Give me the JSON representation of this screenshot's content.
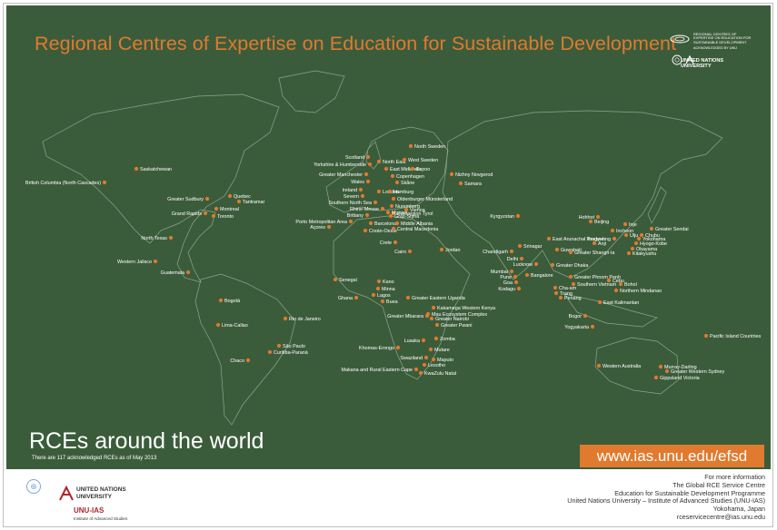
{
  "title": "Regional Centres of Expertise on Education for Sustainable Development",
  "logos_top": {
    "rce_logo_text": "REGIONAL CENTRES OF EXPERTISE ON EDUCATION FOR SUSTAINABLE DEVELOPMENT",
    "acknowledged_text": "ACKNOWLEDGED BY UNU",
    "unu_text": "UNITED NATIONS UNIVERSITY"
  },
  "bottom_left": {
    "heading": "RCEs around the world",
    "subheading": "There are 117 acknowledged RCEs as of May 2013"
  },
  "url": "www.ias.unu.edu/efsd",
  "footer": {
    "unu_name": "UNITED NATIONS UNIVERSITY",
    "unu_ias": "UNU-IAS",
    "unu_ias_sub": "Institute of Advanced Studies",
    "info_lines": [
      "For more information",
      "The Global RCE Service Centre",
      "Education for Sustainable Development Programme",
      "United Nations University – Institute of Advanced Studies (UNU-IAS)",
      "Yokohama, Japan",
      "rceservicecentre@ias.unu.edu"
    ]
  },
  "colors": {
    "background": "#3b5c3b",
    "accent": "#e07a2e",
    "text": "#ffffff"
  },
  "map_labels": [
    "British Columbia (North Cascades)",
    "Saskatchewan",
    "Greater Sudbury",
    "Quebec",
    "Tantramar",
    "Grand Rapids",
    "Montreal",
    "Toronto",
    "North Texas",
    "Western Jalisco",
    "Guatemala",
    "Bogotá",
    "Lima-Callao",
    "Rio de Janeiro",
    "São Paulo",
    "Curitiba-Paraná",
    "Chaco",
    "Scotland",
    "Yorkshire & Humberside",
    "North East",
    "East Midlands",
    "Greater Manchester",
    "Wales",
    "Ireland",
    "Severn",
    "London",
    "Southern North Sea",
    "Rhine-Meuse",
    "Euroregion Tyrol",
    "Brittany",
    "Porto Metropolitan Area",
    "Açores",
    "Barcelona",
    "Creán-Oeste",
    "North Sweden",
    "West Sweden",
    "Espoo",
    "Copenhagen",
    "Skåne",
    "Hamburg",
    "Oldenburger Münsterland",
    "Nuremberg",
    "Munich",
    "Vienna",
    "Graz-Styria",
    "Middle Albania",
    "Central Macedonia",
    "Crete",
    "Cairo",
    "Jordan",
    "Nizhny Novgorod",
    "Samara",
    "Kyrgyzstan",
    "Senegal",
    "Kano",
    "Minna",
    "Lagos",
    "Ghana",
    "Buea",
    "Greater Eastern Uganda",
    "Kakamega Western Kenya",
    "Mau Ecosystem Complex",
    "Greater Nairobi",
    "Greater Mbarara",
    "Greater Pwani",
    "Lusaka",
    "Zomba",
    "Khomas-Erongo",
    "Mutare",
    "Swaziland",
    "Maputo",
    "Lesotho",
    "Makana and Rural Eastern Cape",
    "KwaZulu Natal",
    "Hohhot",
    "Beijing",
    "East Arunachal Pradesh",
    "Srinagar",
    "Chandigarh",
    "Delhi",
    "Guwahati",
    "Greater Shangri-la",
    "Lucknow",
    "Greater Dhaka",
    "Mumbai",
    "Pune",
    "Goa",
    "Kodagu",
    "Bangalore",
    "Cha-am",
    "Trang",
    "Penang",
    "Greater Phnom Penh",
    "Southern Vietnam",
    "Incheon",
    "Ulju",
    "Tongyeong",
    "Anji",
    "Inje",
    "Greater Sendai",
    "Chubu",
    "Yokohama",
    "Hyogo-Kobe",
    "Okayama",
    "Kitakyushu",
    "Bohol",
    "Cebu",
    "Northern Mindanao",
    "Bogor",
    "Yogyakarta",
    "East Kalimantan",
    "Pacific Island Countries",
    "Western Australia",
    "Murray-Darling",
    "Greater Western Sydney",
    "Gippsland Victoria",
    "Tongyeong"
  ]
}
